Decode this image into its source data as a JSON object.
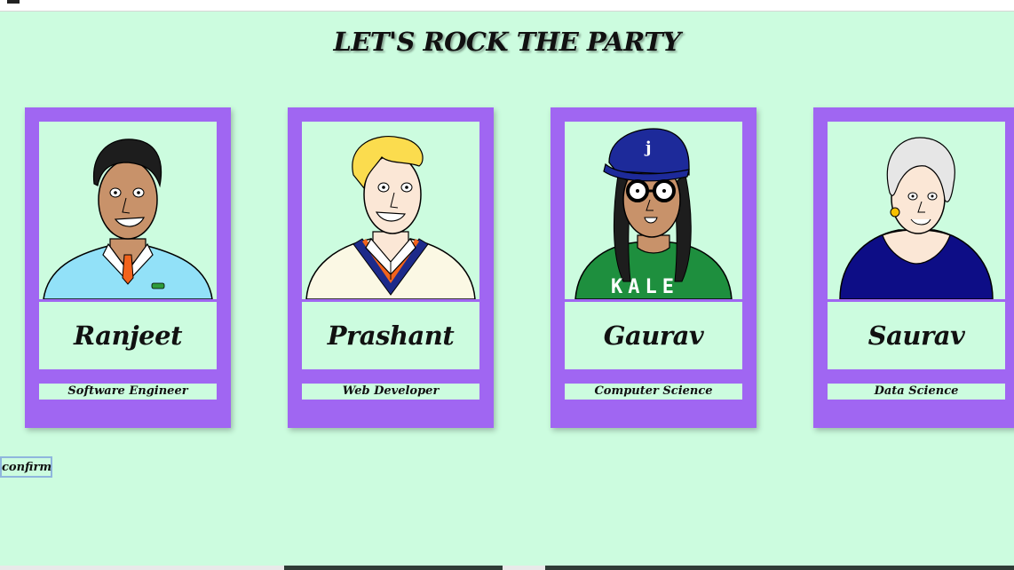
{
  "page": {
    "title": "LET'S ROCK THE PARTY",
    "background": "#ccfcdf",
    "card_color": "#a066f2"
  },
  "cards": [
    {
      "name": "Ranjeet",
      "role": "Software Engineer",
      "avatar_icon": "man-blue-sweater-avatar"
    },
    {
      "name": "Prashant",
      "role": "Web Developer",
      "avatar_icon": "blonde-man-cricket-sweater-avatar"
    },
    {
      "name": "Gaurav",
      "role": "Computer Science",
      "avatar_icon": "woman-cap-glasses-avatar",
      "shirt_text": "KALE"
    },
    {
      "name": "Saurav",
      "role": "Data Science",
      "avatar_icon": "elderly-woman-avatar"
    }
  ],
  "confirm": {
    "label": "confirm"
  }
}
